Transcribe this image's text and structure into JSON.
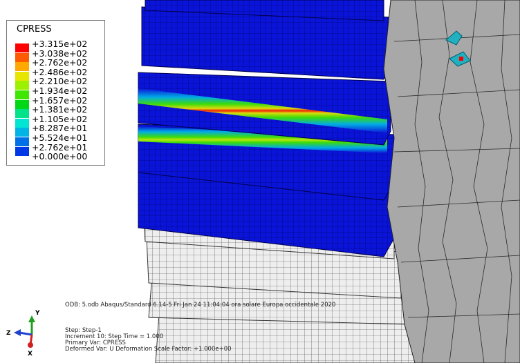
{
  "legend": {
    "title": "CPRESS",
    "entries": [
      {
        "label": "+3.315e+02",
        "color": "#ff0000"
      },
      {
        "label": "+3.038e+02",
        "color": "#ff5a00"
      },
      {
        "label": "+2.762e+02",
        "color": "#ffa800"
      },
      {
        "label": "+2.486e+02",
        "color": "#e6e600"
      },
      {
        "label": "+2.210e+02",
        "color": "#9cf000"
      },
      {
        "label": "+1.934e+02",
        "color": "#3ee600"
      },
      {
        "label": "+1.657e+02",
        "color": "#00d817"
      },
      {
        "label": "+1.381e+02",
        "color": "#00e28a"
      },
      {
        "label": "+1.105e+02",
        "color": "#00e6d2"
      },
      {
        "label": "+8.287e+01",
        "color": "#00b4e6"
      },
      {
        "label": "+5.524e+01",
        "color": "#0070e6"
      },
      {
        "label": "+2.762e+01",
        "color": "#0038e6"
      },
      {
        "label": "+0.000e+00",
        "color": "#0000e6"
      }
    ]
  },
  "info": {
    "odb": "ODB: 5.odb    Abaqus/Standard 6.14-5    Fri Jan 24 11:04:04 ora solare Europa occidentale 2020",
    "step": "Step: Step-1",
    "increment": "Increment     10: Step Time =     1.000",
    "primary": "Primary Var: CPRESS",
    "deformed": "Deformed Var: U   Deformation Scale Factor: +1.000e+00"
  },
  "triad": {
    "x": "X",
    "y": "Y",
    "z": "Z"
  }
}
